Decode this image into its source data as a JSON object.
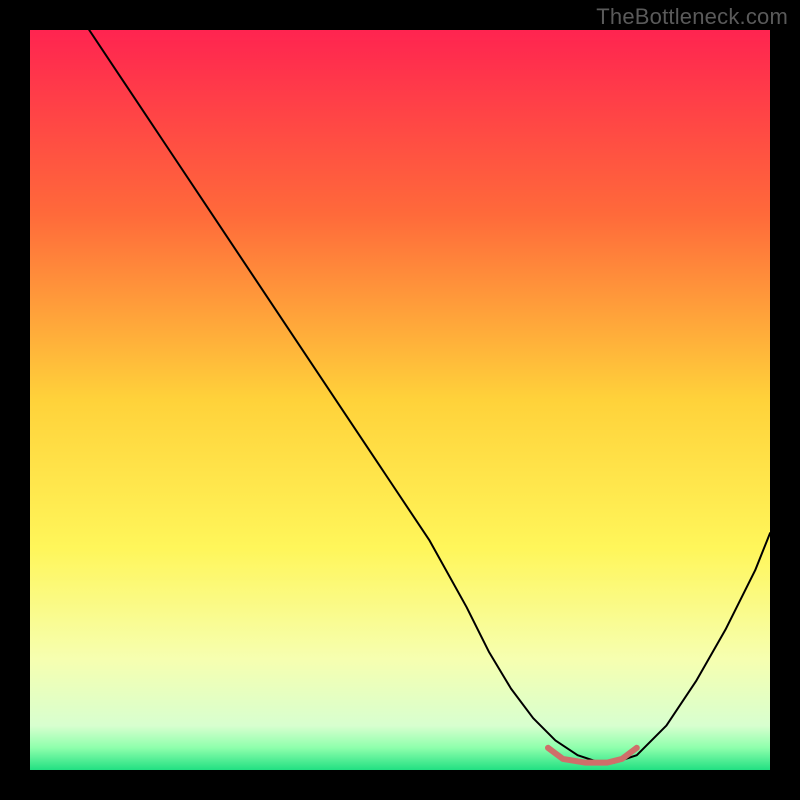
{
  "watermark": "TheBottleneck.com",
  "chart_data": {
    "type": "line",
    "title": "",
    "xlabel": "",
    "ylabel": "",
    "xlim": [
      0,
      100
    ],
    "ylim": [
      0,
      100
    ],
    "grid": false,
    "legend": false,
    "background_gradient_stops": [
      {
        "offset": 0.0,
        "color": "#ff2450"
      },
      {
        "offset": 0.25,
        "color": "#ff6a3a"
      },
      {
        "offset": 0.5,
        "color": "#ffd23a"
      },
      {
        "offset": 0.7,
        "color": "#fff65a"
      },
      {
        "offset": 0.85,
        "color": "#f6ffb0"
      },
      {
        "offset": 0.94,
        "color": "#d8ffcf"
      },
      {
        "offset": 0.97,
        "color": "#8effac"
      },
      {
        "offset": 1.0,
        "color": "#22e082"
      }
    ],
    "series": [
      {
        "name": "bottleneck-curve",
        "stroke": "#000000",
        "stroke_width": 2,
        "x": [
          8,
          12,
          18,
          24,
          30,
          36,
          42,
          48,
          54,
          59,
          62,
          65,
          68,
          71,
          74,
          77,
          79,
          82,
          86,
          90,
          94,
          98,
          100
        ],
        "y": [
          100,
          94,
          85,
          76,
          67,
          58,
          49,
          40,
          31,
          22,
          16,
          11,
          7,
          4,
          2,
          1,
          1,
          2,
          6,
          12,
          19,
          27,
          32
        ]
      },
      {
        "name": "optimal-zone",
        "stroke": "#cf6f6a",
        "stroke_width": 6,
        "x": [
          70,
          72,
          75,
          78,
          80,
          82
        ],
        "y": [
          3,
          1.5,
          1,
          1,
          1.5,
          3
        ]
      }
    ]
  }
}
